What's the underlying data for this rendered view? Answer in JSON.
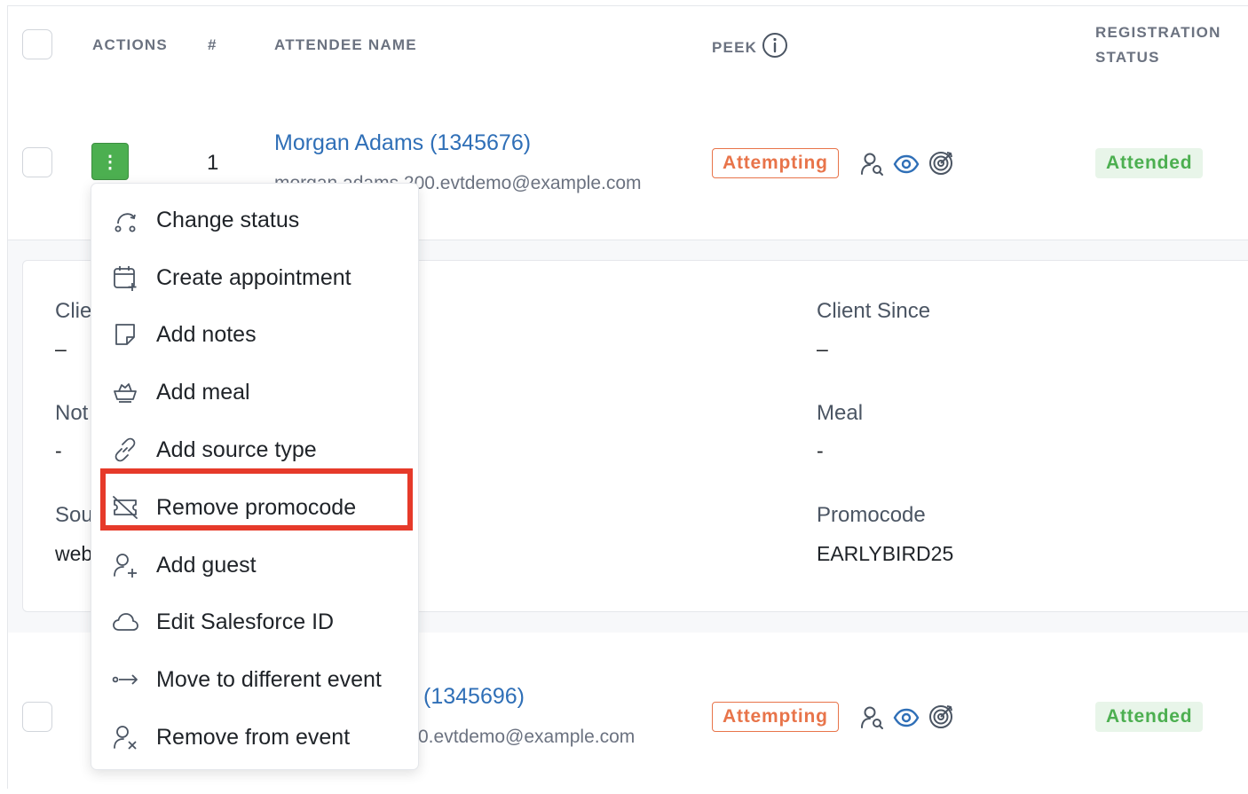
{
  "header": {
    "actions": "ACTIONS",
    "number": "#",
    "attendee_name": "ATTENDEE NAME",
    "peek": "PEEK",
    "registration_status_line1": "REGISTRATION",
    "registration_status_line2": "STATUS"
  },
  "rows": [
    {
      "number": "1",
      "name": "Morgan Adams (1345676)",
      "email": "morgan.adams.200.evtdemo@example.com",
      "peek_status": "Attempting",
      "registration_status": "Attended"
    },
    {
      "name_visible": "(1345696)",
      "email_visible": "0.evtdemo@example.com",
      "peek_status": "Attempting",
      "registration_status": "Attended"
    }
  ],
  "details": {
    "left": [
      {
        "label_visible": "Clie",
        "value": "–"
      },
      {
        "label_visible": "Not",
        "value": "-"
      },
      {
        "label_visible": "Sou",
        "value_visible": "web"
      }
    ],
    "right": [
      {
        "label": "Client Since",
        "value": "–"
      },
      {
        "label": "Meal",
        "value": "-"
      },
      {
        "label": "Promocode",
        "value": "EARLYBIRD25"
      }
    ]
  },
  "action_button_glyph": "⋮",
  "menu": {
    "items": [
      {
        "label": "Change status",
        "icon": "change-status-icon"
      },
      {
        "label": "Create appointment",
        "icon": "calendar-plus-icon"
      },
      {
        "label": "Add notes",
        "icon": "sticky-note-icon"
      },
      {
        "label": "Add meal",
        "icon": "meal-bowl-icon"
      },
      {
        "label": "Add source type",
        "icon": "link-icon"
      },
      {
        "label": "Remove promocode",
        "icon": "ticket-off-icon"
      },
      {
        "label": "Add guest",
        "icon": "user-plus-icon"
      },
      {
        "label": "Edit Salesforce ID",
        "icon": "cloud-icon"
      },
      {
        "label": "Move to different event",
        "icon": "move-arrow-icon"
      },
      {
        "label": "Remove from event",
        "icon": "user-x-icon"
      }
    ],
    "highlighted_item": "Remove promocode"
  },
  "colors": {
    "action_green": "#4caf50",
    "link_blue": "#2f6fb7",
    "attempting_orange": "#e8744a",
    "attended_green": "#4caf50",
    "highlight_red": "#e63a2a"
  }
}
